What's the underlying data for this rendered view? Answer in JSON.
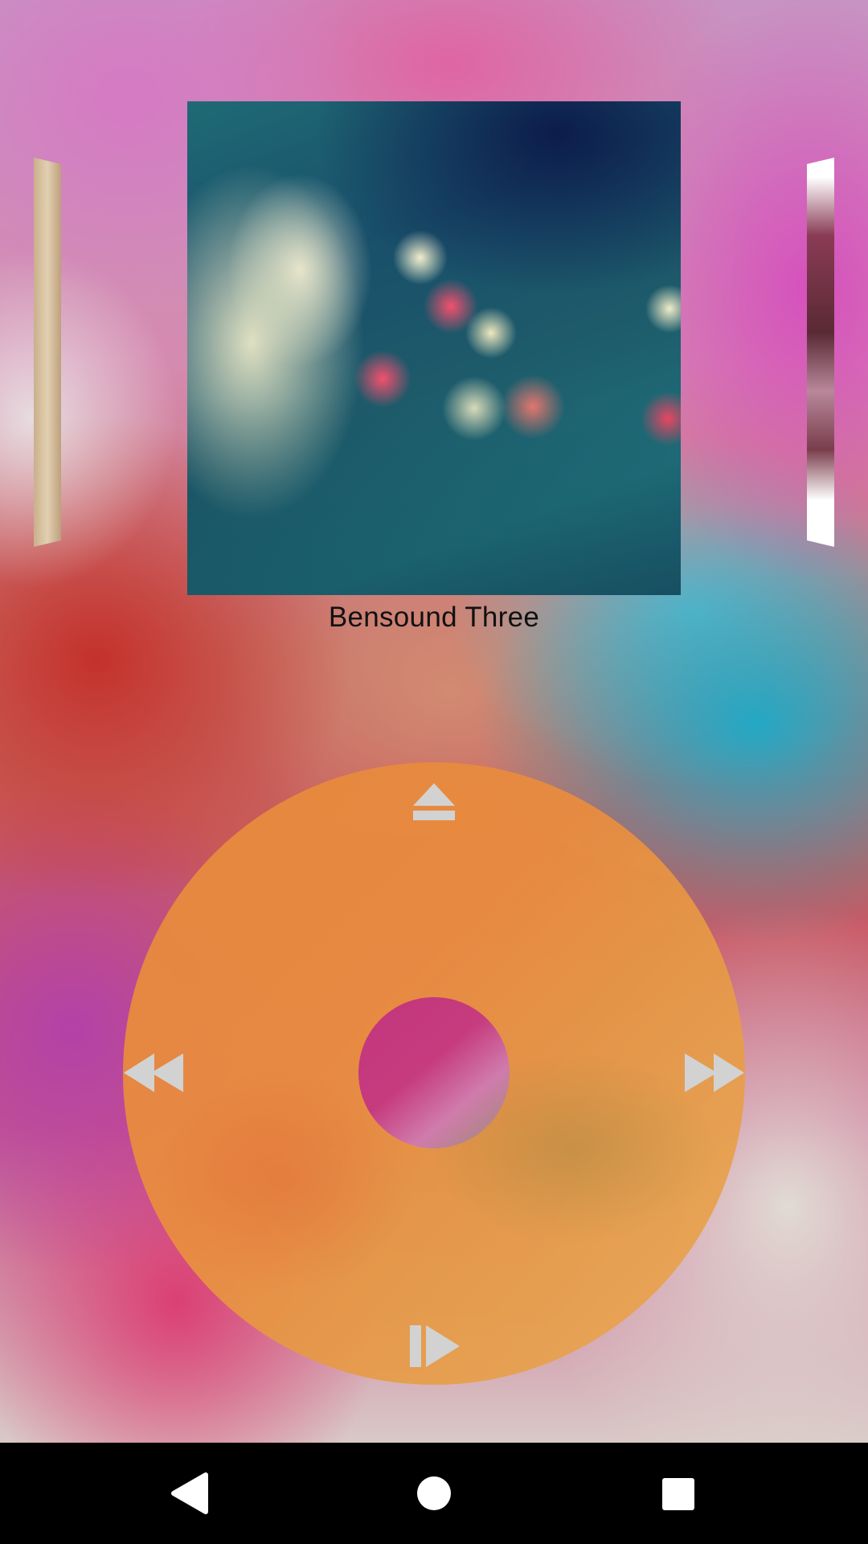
{
  "now_playing": {
    "track_title": "Bensound Three"
  },
  "album_carousel": {
    "items": [
      {
        "name": "previous-album-cover"
      },
      {
        "name": "current-album-cover"
      },
      {
        "name": "next-album-cover"
      }
    ]
  },
  "click_wheel": {
    "controls": [
      {
        "icon": "eject-icon"
      },
      {
        "icon": "rewind-icon"
      },
      {
        "icon": "fast-forward-icon"
      },
      {
        "icon": "play-pause-icon"
      },
      {
        "icon": "center-select-button"
      }
    ],
    "colors": {
      "wheel": "#e88a3c",
      "center": "#c3357c",
      "icon": "#d2d2d2"
    }
  },
  "navigation_bar": {
    "buttons": [
      "back-icon",
      "home-icon",
      "recents-icon"
    ],
    "background": "#000000",
    "icon_color": "#ffffff"
  }
}
